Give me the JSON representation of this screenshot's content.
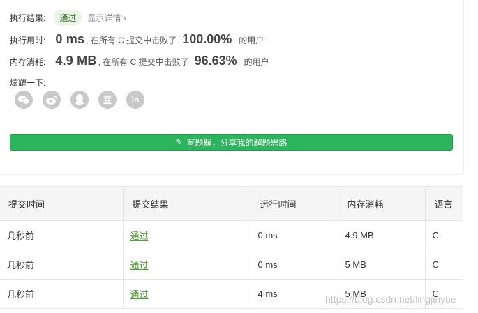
{
  "result": {
    "label": "执行结果:",
    "status": "通过",
    "details": "显示详情 ›"
  },
  "runtime": {
    "label": "执行用时:",
    "value": "0 ms",
    "mid": ", 在所有 C 提交中击败了",
    "percent": "100.00%",
    "suffix": "的用户"
  },
  "memory": {
    "label": "内存消耗:",
    "value": "4.9 MB",
    "mid": ", 在所有 C 提交中击败了",
    "percent": "96.63%",
    "suffix": "的用户"
  },
  "share": {
    "label": "炫耀一下:",
    "icons": [
      {
        "name": "wechat-icon",
        "glyph": ""
      },
      {
        "name": "weibo-icon",
        "glyph": ""
      },
      {
        "name": "qq-icon",
        "glyph": ""
      },
      {
        "name": "douban-icon",
        "glyph": "豆"
      },
      {
        "name": "linkedin-icon",
        "glyph": "in"
      }
    ]
  },
  "write_button": {
    "label": "写题解，分享我的解题思路"
  },
  "table": {
    "headers": [
      "提交时间",
      "提交结果",
      "运行时间",
      "内存消耗",
      "语言"
    ],
    "rows": [
      [
        "几秒前",
        "通过",
        "0 ms",
        "4.9 MB",
        "C"
      ],
      [
        "几秒前",
        "通过",
        "0 ms",
        "5 MB",
        "C"
      ],
      [
        "几秒前",
        "通过",
        "4 ms",
        "5 MB",
        "C"
      ]
    ]
  },
  "watermark": "https://blog.csdn.net/lingjinyue"
}
